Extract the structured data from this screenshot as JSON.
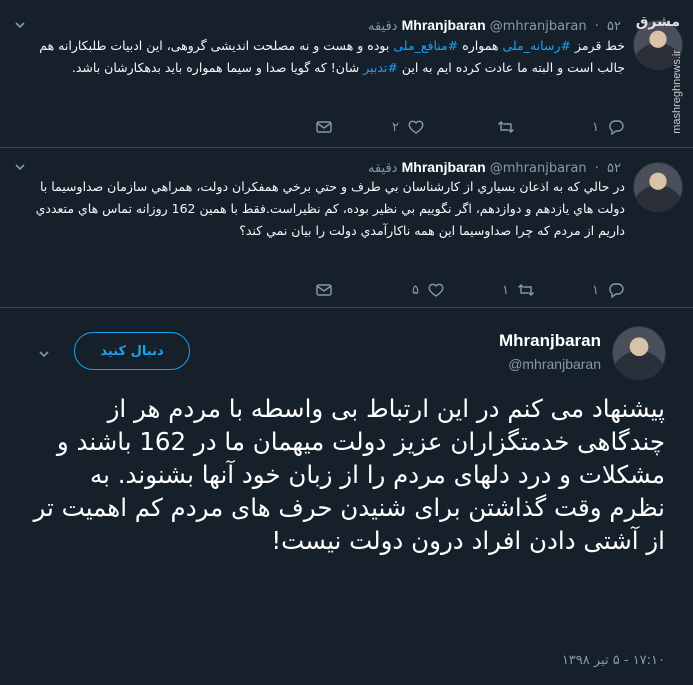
{
  "tweets": [
    {
      "name": "Mhranjbaran",
      "handle": "@mhranjbaran",
      "time": "۵۲ دقیقه",
      "text_a": "خط قرمز ",
      "tag1": "#رسانه_ملی",
      "text_b": " همواره ",
      "tag2": "#منافع_ملی",
      "text_c": " بوده و هست و نه مصلحت اندیشی گروهی، این ادبیات طلبکارانه هم جالب است و البته ما عادت کرده ایم به این ",
      "tag3": "#تدبیر",
      "text_d": " شان! که گویا صدا و سیما همواره باید بدهکارشان باشد.",
      "reply_count": "۱",
      "retweet_count": "",
      "like_count": "۲"
    },
    {
      "name": "Mhranjbaran",
      "handle": "@mhranjbaran",
      "time": "۵۲ دقیقه",
      "text": "در حالي كه به اذعان بسياري از كارشناسان بي طرف و حتي برخي همفكران دولت، همراهي سازمان صداوسيما با دولت هاي يازدهم و دوازدهم، اگر نگوييم بي نظير بوده، كم نظيراست.فقط با همين 162 روزانه تماس هاي متعددي داريم از مردم كه چرا صداوسيما اين همه ناكارآمدي دولت  را بيان نمي كند؟",
      "reply_count": "۱",
      "retweet_count": "۱",
      "like_count": "۵"
    }
  ],
  "main": {
    "name": "Mhranjbaran",
    "handle": "@mhranjbaran",
    "follow_label": "دنبال کنید",
    "text": "پیشنهاد می کنم در این ارتباط بی واسطه با مردم هر از چندگاهی خدمتگزاران عزیز دولت میهمان ما در 162 باشند و مشکلات و درد دلهای مردم را از زبان خود آنها بشنوند. به نظرم وقت گذاشتن برای شنیدن حرف های مردم کم اهمیت تر از آشتی دادن افراد درون دولت نیست!",
    "timestamp": "۱۷:۱۰ - ۵ تیر ۱۳۹۸"
  },
  "watermark": {
    "logo": "مشرق",
    "site": "mashreghnews.ir"
  },
  "colors": {
    "background": "#15202b",
    "accent": "#1da1f2",
    "muted": "#8899a6",
    "border": "#38444d"
  },
  "icons": [
    "reply-icon",
    "retweet-icon",
    "like-icon",
    "dm-icon",
    "chevron-down-icon"
  ]
}
